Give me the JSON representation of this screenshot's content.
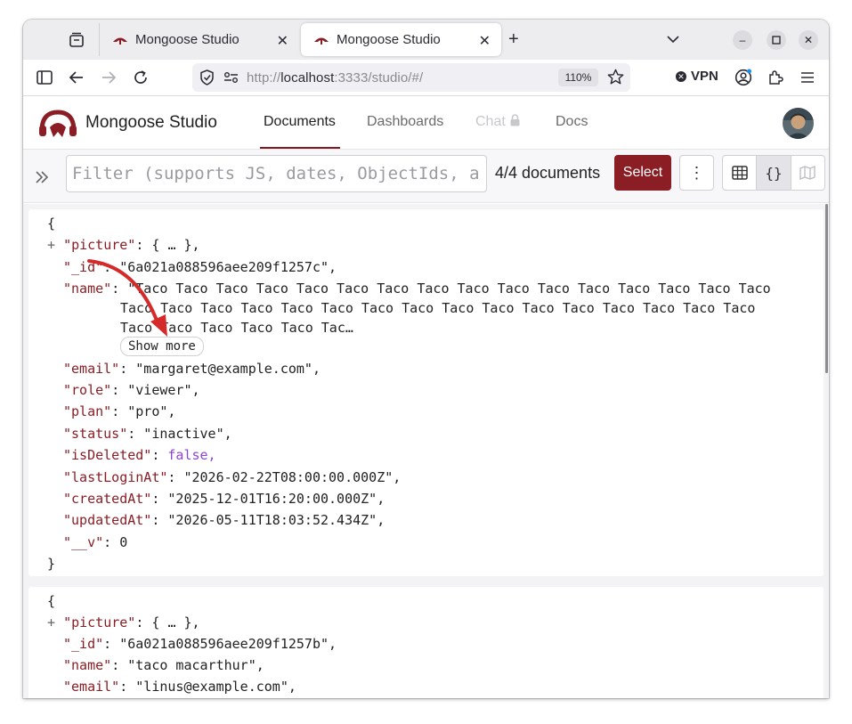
{
  "browser": {
    "tabs": [
      {
        "title": "Mongoose Studio"
      },
      {
        "title": "Mongoose Studio"
      }
    ],
    "url": {
      "host": "localhost",
      "rest": ":3333/studio/#/",
      "prefix": "http://"
    },
    "zoom": "110%",
    "vpn_label": "VPN"
  },
  "app": {
    "brand": "Mongoose Studio",
    "nav": [
      {
        "label": "Documents"
      },
      {
        "label": "Dashboards"
      },
      {
        "label": "Chat"
      },
      {
        "label": "Docs"
      }
    ]
  },
  "toolbar": {
    "filter_placeholder": "Filter (supports JS, dates, ObjectIds, and more)",
    "doc_count": "4/4 documents",
    "select_label": "Select",
    "more_label": "⋮",
    "view_json_label": "{}"
  },
  "documents": [
    {
      "open_brace": "{",
      "close_brace": "}",
      "expand": "+",
      "picture_key": "\"picture\"",
      "picture_val": ": { … },",
      "id_key": "\"_id\"",
      "id_val": ": \"6a021a088596aee209f1257c\",",
      "name_key": "\"name\"",
      "name_line1": ": \"Taco Taco Taco Taco Taco Taco Taco Taco Taco Taco Taco Taco Taco Taco Taco Taco",
      "name_line2": "Taco Taco Taco Taco Taco Taco Taco Taco Taco Taco Taco Taco Taco Taco Taco Taco",
      "name_line3": "Taco Taco Taco Taco Taco Tac…",
      "show_more": "Show more",
      "email_key": "\"email\"",
      "email_val": ": \"margaret@example.com\",",
      "role_key": "\"role\"",
      "role_val": ": \"viewer\",",
      "plan_key": "\"plan\"",
      "plan_val": ": \"pro\",",
      "status_key": "\"status\"",
      "status_val": ": \"inactive\",",
      "isDeleted_key": "\"isDeleted\"",
      "isDeleted_sep": ": ",
      "isDeleted_val": "false,",
      "lastLoginAt_key": "\"lastLoginAt\"",
      "lastLoginAt_val": ": \"2026-02-22T08:00:00.000Z\",",
      "createdAt_key": "\"createdAt\"",
      "createdAt_val": ": \"2025-12-01T16:20:00.000Z\",",
      "updatedAt_key": "\"updatedAt\"",
      "updatedAt_val": ": \"2026-05-11T18:03:52.434Z\",",
      "v_key": "\"__v\"",
      "v_val": ": 0"
    },
    {
      "open_brace": "{",
      "expand": "+",
      "picture_key": "\"picture\"",
      "picture_val": ": { … },",
      "id_key": "\"_id\"",
      "id_val": ": \"6a021a088596aee209f1257b\",",
      "name_key": "\"name\"",
      "name_val": ": \"taco macarthur\",",
      "email_key": "\"email\"",
      "email_val": ": \"linus@example.com\","
    }
  ],
  "colors": {
    "accent": "#8b1d24",
    "key": "#8b1d24",
    "boolean": "#8e44d6",
    "annotation_arrow": "#d42a2a"
  }
}
